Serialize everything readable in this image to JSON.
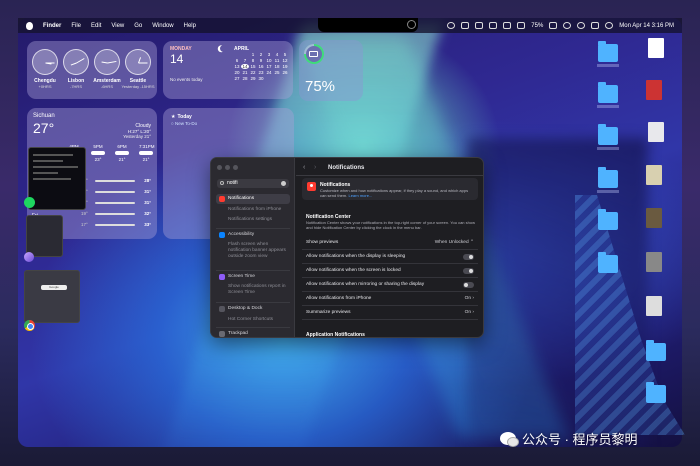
{
  "menubar": {
    "app": "Finder",
    "items": [
      "File",
      "Edit",
      "View",
      "Go",
      "Window",
      "Help"
    ],
    "battery": "75%",
    "datetime": "Mon Apr 14  3:16 PM"
  },
  "clocks": [
    {
      "city": "Chengdu",
      "offset": "+0HRS"
    },
    {
      "city": "Lisbon",
      "offset": "-7HRS"
    },
    {
      "city": "Amsterdam",
      "offset": "-6HRS"
    },
    {
      "city": "Seattle",
      "offset": "Yesterday -15HRS"
    }
  ],
  "calendar": {
    "month_left": "MONDAY",
    "day": "14",
    "no_events": "No events today",
    "month_right": "APRIL",
    "grid": [
      "",
      "",
      "1",
      "2",
      "3",
      "4",
      "5",
      "6",
      "7",
      "8",
      "9",
      "10",
      "11",
      "12",
      "13",
      "14",
      "15",
      "16",
      "17",
      "18",
      "19",
      "20",
      "21",
      "22",
      "23",
      "24",
      "25",
      "26",
      "27",
      "28",
      "29",
      "30",
      "",
      "",
      ""
    ],
    "today_index": 15
  },
  "battery_widget": {
    "percent": "75%",
    "level": 0.75
  },
  "weather": {
    "city": "Sichuan",
    "temp": "27°",
    "condition": "Cloudy",
    "high_low": "H:27° L:20°",
    "yesterday": "Yesterday 21°",
    "hours": [
      {
        "time": "4PM",
        "temp": "24°"
      },
      {
        "time": "5PM",
        "temp": "23°"
      },
      {
        "time": "6PM",
        "temp": "21°"
      },
      {
        "time": "7:31PM",
        "temp": "21°"
      }
    ],
    "days": [
      {
        "lo": "20°",
        "hi": "28°"
      },
      {
        "lo": "19°",
        "hi": "31°"
      },
      {
        "lo": "19°",
        "hi": "31°"
      },
      {
        "lo": "19°",
        "hi": "32°"
      },
      {
        "lo": "17°",
        "hi": "33°"
      }
    ],
    "day_label": "Fri"
  },
  "today": {
    "title": "Today",
    "todo": "New To-Do"
  },
  "thumb_google": "Google",
  "settings": {
    "search_value": "notifi",
    "sidebar": [
      {
        "label": "Notifications",
        "type": "selected",
        "color": "#ff3b30"
      },
      {
        "label": "Notifications from iPhone",
        "type": "sub"
      },
      {
        "label": "Notifications settings",
        "type": "sub"
      },
      {
        "label": "Accessibility",
        "type": "cat",
        "color": "#0a84ff"
      },
      {
        "label": "Flash screen when notification banner appears outside zoom view",
        "type": "sub"
      },
      {
        "label": "Screen Time",
        "type": "cat",
        "color": "#8e5cf7"
      },
      {
        "label": "Show notifications report in Screen Time",
        "type": "sub"
      },
      {
        "label": "Desktop & Dock",
        "type": "cat",
        "color": "#3a3a40"
      },
      {
        "label": "Hot Corner Shortcuts",
        "type": "sub"
      },
      {
        "label": "Trackpad",
        "type": "cat",
        "color": "#6a6a72"
      }
    ],
    "pane_title": "Notifications",
    "hero_title": "Notifications",
    "hero_desc": "Customize when and how notifications appear, if they play a sound, and which apps can send them.",
    "hero_link": "Learn more...",
    "nc_title": "Notification Center",
    "nc_desc": "Notification Center shows your notifications in the top-right corner of your screen. You can show and hide Notification Center by clicking the clock in the menu bar.",
    "rows": [
      {
        "label": "Show previews",
        "value": "When Unlocked ⌃",
        "kind": "select"
      },
      {
        "label": "Allow notifications when the display is sleeping",
        "kind": "toggle",
        "on": true
      },
      {
        "label": "Allow notifications when the screen is locked",
        "kind": "toggle",
        "on": true
      },
      {
        "label": "Allow notifications when mirroring or sharing the display",
        "kind": "toggle",
        "on": false
      },
      {
        "label": "Allow notifications from iPhone",
        "value": "On ›",
        "kind": "link"
      },
      {
        "label": "Summarize previews",
        "value": "On ›",
        "kind": "link"
      }
    ],
    "app_notifications": "Application Notifications"
  },
  "watermark": "公众号 · 程序员黎明"
}
